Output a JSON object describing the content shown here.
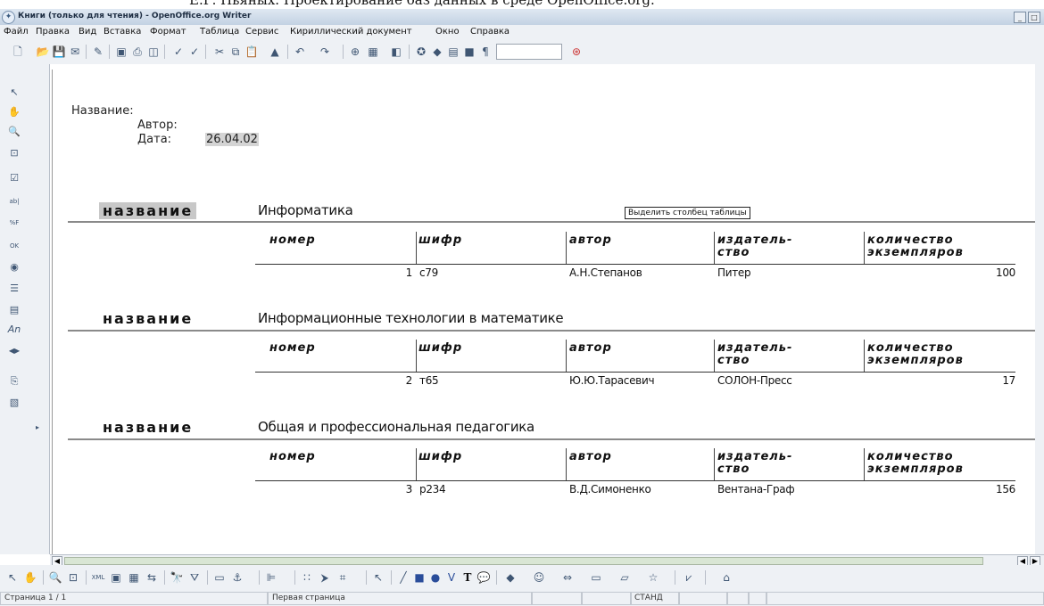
{
  "headline": "Е.Г. Пьяных. Проектирование баз данных в среде OpenOffice.org.",
  "window": {
    "title": "Книги (только для чтения) - OpenOffice.org Writer"
  },
  "menu": [
    "Файл",
    "Правка",
    "Вид",
    "Вставка",
    "Формат",
    "Таблица",
    "Сервис",
    "Кириллический документ",
    "Окно",
    "Справка"
  ],
  "toolbar_icons": [
    "new-icon",
    "open-icon",
    "save-icon",
    "mail-icon",
    "edit-icon",
    "pdf-icon",
    "print-icon",
    "preview-icon",
    "spellcheck-icon",
    "autospell-icon",
    "cut-icon",
    "copy-icon",
    "paste-icon",
    "format-paint-icon",
    "undo-icon",
    "redo-icon",
    "hyperlink-icon",
    "table-icon",
    "show-draw-icon",
    "navigator-icon",
    "gallery-icon",
    "datasource-icon",
    "nonprint-chars-icon",
    "zoom-combo",
    "help-icon"
  ],
  "leftbar_icons": [
    "select-icon",
    "hand-icon",
    "zoom-icon",
    "zoom-fit-icon",
    "checkbox-icon",
    "text-field-icon",
    "formatted-field-icon",
    "button-icon",
    "radio-icon",
    "list-box-icon",
    "combo-box-icon",
    "label-icon",
    "navigation-bar-icon",
    "form-icon",
    "design-icon",
    "more-icon"
  ],
  "report": {
    "header": {
      "name_label": "Название:",
      "author_label": "Автор:",
      "date_label": "Дата:",
      "date_value": "26.04.02"
    },
    "tooltip": "Выделить столбец таблицы",
    "columns": [
      "номер",
      "шифр",
      "автор",
      "издатель-\nство",
      "количество\nэкземпляров"
    ],
    "groups": [
      {
        "label": "название",
        "title": "Информатика",
        "row": {
          "num": "1",
          "code": "c79",
          "author": "А.Н.Степанов",
          "publisher": "Питер",
          "count": "100"
        }
      },
      {
        "label": "название",
        "title": "Информационные технологии в математике",
        "row": {
          "num": "2",
          "code": "т65",
          "author": "Ю.Ю.Тарасевич",
          "publisher": "СОЛОН-Пресс",
          "count": "17"
        }
      },
      {
        "label": "название",
        "title": "Общая и профессиональная педагогика",
        "row": {
          "num": "3",
          "code": "p234",
          "author": "В.Д.Симоненко",
          "publisher": "Вентана-Граф",
          "count": "156"
        }
      }
    ]
  },
  "status": {
    "page": "Страница  1 / 1",
    "style": "Первая страница",
    "mode": "СТАНД"
  }
}
